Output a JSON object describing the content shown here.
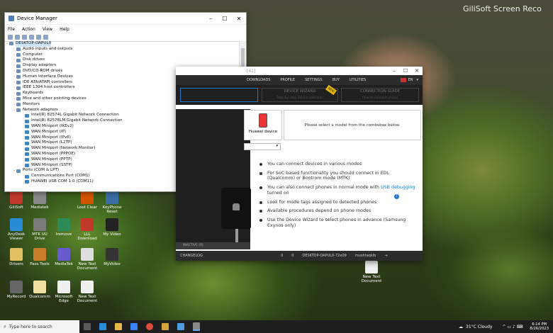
{
  "watermark": "GiliSoft Screen Reco",
  "device_manager": {
    "title": "Device Manager",
    "menu": [
      "File",
      "Action",
      "View",
      "Help"
    ],
    "root": "DESKTOP-OAPUL0",
    "items": [
      {
        "label": "Audio inputs and outputs",
        "expand": "collapsed",
        "level": 1
      },
      {
        "label": "Computer",
        "expand": "collapsed",
        "level": 1
      },
      {
        "label": "Disk drives",
        "expand": "collapsed",
        "level": 1
      },
      {
        "label": "Display adapters",
        "expand": "collapsed",
        "level": 1
      },
      {
        "label": "DVD/CD-ROM drives",
        "expand": "collapsed",
        "level": 1
      },
      {
        "label": "Human Interface Devices",
        "expand": "collapsed",
        "level": 1
      },
      {
        "label": "IDE ATA/ATAPI controllers",
        "expand": "collapsed",
        "level": 1
      },
      {
        "label": "IEEE 1394 host controllers",
        "expand": "collapsed",
        "level": 1
      },
      {
        "label": "Keyboards",
        "expand": "collapsed",
        "level": 1
      },
      {
        "label": "Mice and other pointing devices",
        "expand": "collapsed",
        "level": 1
      },
      {
        "label": "Monitors",
        "expand": "collapsed",
        "level": 1
      },
      {
        "label": "Network adapters",
        "expand": "expanded",
        "level": 1
      },
      {
        "label": "Intel(R) 82574L Gigabit Network Connection",
        "expand": "none",
        "level": 2
      },
      {
        "label": "Intel(R) 82578LM Gigabit Network Connection",
        "expand": "none",
        "level": 2
      },
      {
        "label": "WAN Miniport (IKEv2)",
        "expand": "none",
        "level": 2
      },
      {
        "label": "WAN Miniport (IP)",
        "expand": "none",
        "level": 2
      },
      {
        "label": "WAN Miniport (IPv6)",
        "expand": "none",
        "level": 2
      },
      {
        "label": "WAN Miniport (L2TP)",
        "expand": "none",
        "level": 2
      },
      {
        "label": "WAN Miniport (Network Monitor)",
        "expand": "none",
        "level": 2
      },
      {
        "label": "WAN Miniport (PPPOE)",
        "expand": "none",
        "level": 2
      },
      {
        "label": "WAN Miniport (PPTP)",
        "expand": "none",
        "level": 2
      },
      {
        "label": "WAN Miniport (SSTP)",
        "expand": "none",
        "level": 2
      },
      {
        "label": "Ports (COM & LPT)",
        "expand": "expanded",
        "level": 1
      },
      {
        "label": "Communications Port (COM1)",
        "expand": "none",
        "level": 2
      },
      {
        "label": "HUAWEI USB COM 1.0 (COM11)",
        "expand": "none",
        "level": 2
      }
    ]
  },
  "app": {
    "title_suffix": "[41]",
    "nav": [
      "DOWNLOADS",
      "PROFILE",
      "SETTINGS",
      "BUY",
      "UTILITIES"
    ],
    "lang": "EN",
    "steps": {
      "wizard": "DEVICE WIZARD",
      "wizard_sub": "Step by step device selection",
      "guide": "CONNECTION GUIDE",
      "guide_sub": "How to connect phone"
    },
    "badge": "NEW",
    "device_tile": "Huawei device",
    "model_prompt": "Please select a model from the combobox below.",
    "bullets": [
      {
        "text": "You can connect devices in various modes"
      },
      {
        "text": "For SoC based functionality you should connect in EDL (Qualcomm) or Bootrom mode (MTK)"
      },
      {
        "pre": "You can also connect phones in normal mode with ",
        "link": "USB debugging",
        "post": " turned on"
      },
      {
        "text": "Look for mode tags assigned to detected phones"
      },
      {
        "text": "Available procedures depend on phone modes"
      },
      {
        "text": "Use the Device Wizard to select phones in advance (Samsung Exynos only)"
      }
    ],
    "inactive": "INACTIVE (0)",
    "status": {
      "changelog": "CHANGELOG",
      "c1": "0",
      "c2": "0",
      "pc": "DESKTOP-OAPUL0-72e09",
      "user": "mushtaqkib"
    }
  },
  "desktop_icons": [
    {
      "label": "GiliSoft"
    },
    {
      "label": "Mediatek"
    },
    {
      "label": "Loot Clear"
    },
    {
      "label": "KeyPhone Reset"
    },
    {
      "label": "AnyDesk Viewer"
    },
    {
      "label": "MTK UU Drive"
    },
    {
      "label": "Iremove"
    },
    {
      "label": "LLL Download"
    },
    {
      "label": "My Video"
    },
    {
      "label": "Drivers"
    },
    {
      "label": "Pass Tools"
    },
    {
      "label": "MediaTek"
    },
    {
      "label": "New Text Document"
    },
    {
      "label": "MyVideo"
    },
    {
      "label": "MyRecord"
    },
    {
      "label": "Qualcomm"
    },
    {
      "label": "Microsoft Edge"
    },
    {
      "label": "New Text Document"
    },
    {
      "label": "New Text Document"
    }
  ],
  "taskbar": {
    "search_placeholder": "Type here to search",
    "weather": "31°C  Cloudy",
    "time": "6:14 PM",
    "date": "8/26/2023"
  }
}
